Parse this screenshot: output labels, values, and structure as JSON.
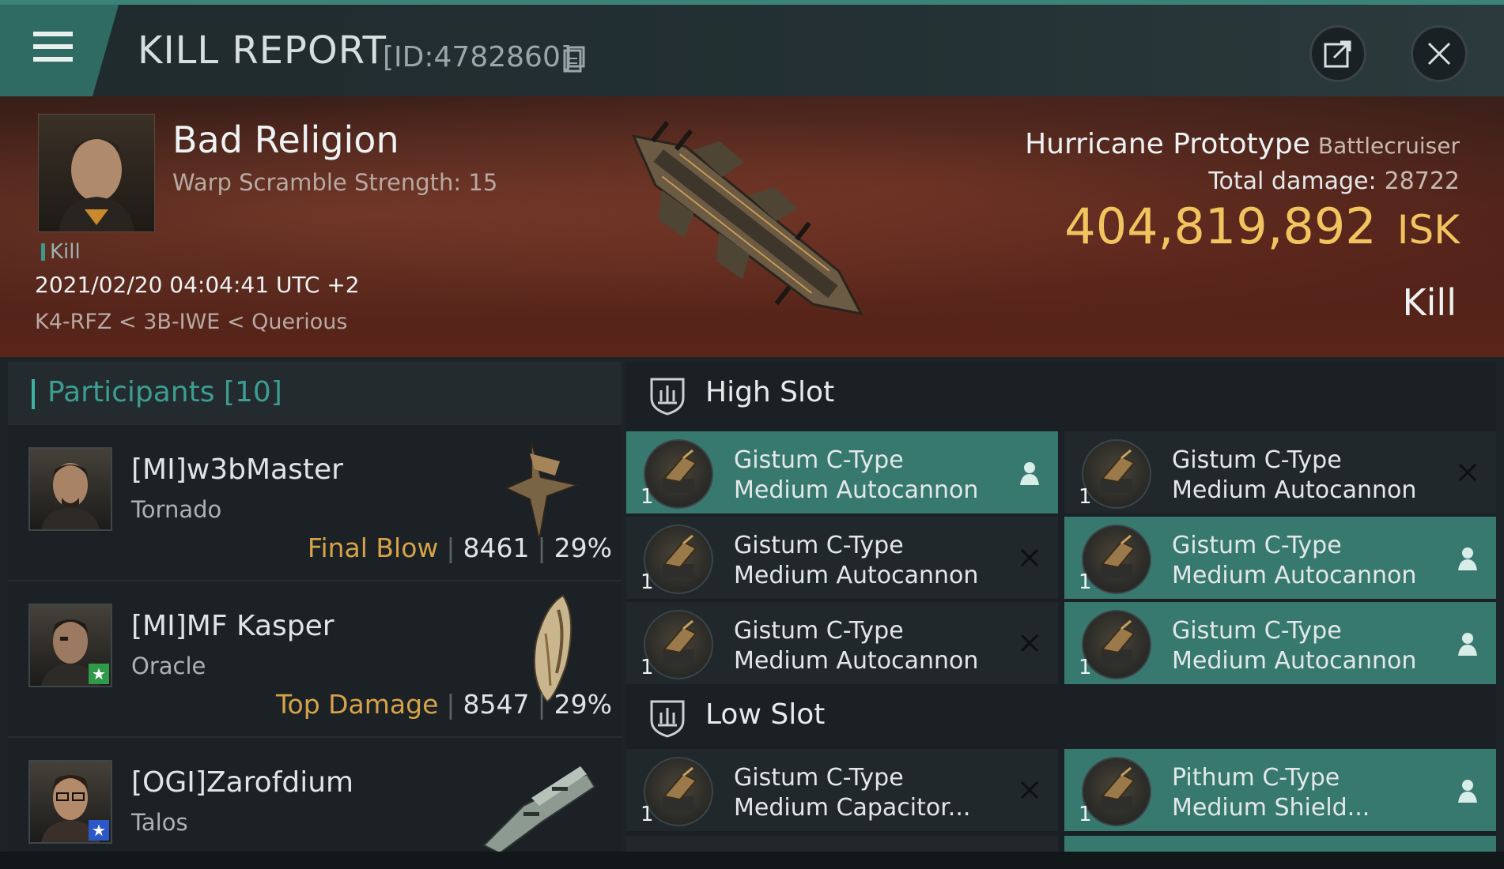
{
  "header": {
    "title": "KILL REPORT",
    "report_id": "[ID:4782860]",
    "icons": [
      "menu-icon",
      "copy-icon",
      "share-icon",
      "close-icon"
    ]
  },
  "victim": {
    "name": "Bad Religion",
    "subtitle": "Warp Scramble Strength: 15",
    "tag": "Kill",
    "datetime": "2021/02/20 04:04:41 UTC +2",
    "location": "K4-RFZ < 3B-IWE < Querious",
    "ship_name": "Hurricane Prototype",
    "ship_class": "Battlecruiser",
    "total_damage_label": "Total damage:",
    "total_damage": "28722",
    "isk_value": "404,819,892",
    "isk_unit": "ISK",
    "result": "Kill"
  },
  "participants": {
    "title": "Participants [10]",
    "rows": [
      {
        "name": "[MI]w3bMaster",
        "ship": "Tornado",
        "tag": "Final Blow",
        "damage": "8461",
        "percent": "29%",
        "badge": ""
      },
      {
        "name": "[MI]MF Kasper",
        "ship": "Oracle",
        "tag": "Top Damage",
        "damage": "8547",
        "percent": "29%",
        "badge": "star"
      },
      {
        "name": "[OGI]Zarofdium",
        "ship": "Talos",
        "tag": "",
        "damage": "",
        "percent": "",
        "badge": "star"
      }
    ]
  },
  "fitting": {
    "high_slot_label": "High Slot",
    "low_slot_label": "Low Slot",
    "high": [
      {
        "qty": "1",
        "line1": "Gistum C-Type",
        "line2": "Medium Autocannon",
        "state": "dropped"
      },
      {
        "qty": "1",
        "line1": "Gistum C-Type",
        "line2": "Medium Autocannon",
        "state": "destroyed"
      },
      {
        "qty": "1",
        "line1": "Gistum C-Type",
        "line2": "Medium Autocannon",
        "state": "destroyed"
      },
      {
        "qty": "1",
        "line1": "Gistum C-Type",
        "line2": "Medium Autocannon",
        "state": "dropped"
      },
      {
        "qty": "1",
        "line1": "Gistum C-Type",
        "line2": "Medium Autocannon",
        "state": "destroyed"
      },
      {
        "qty": "1",
        "line1": "Gistum C-Type",
        "line2": "Medium Autocannon",
        "state": "dropped"
      }
    ],
    "low": [
      {
        "qty": "1",
        "line1": "Gistum C-Type",
        "line2": "Medium Capacitor...",
        "state": "destroyed"
      },
      {
        "qty": "1",
        "line1": "Pithum C-Type",
        "line2": "Medium Shield...",
        "state": "dropped"
      }
    ]
  },
  "colors": {
    "accent": "#3b8279",
    "dropped_row": "#38796f",
    "isk": "#f2c460",
    "tag": "#d7a34a"
  }
}
